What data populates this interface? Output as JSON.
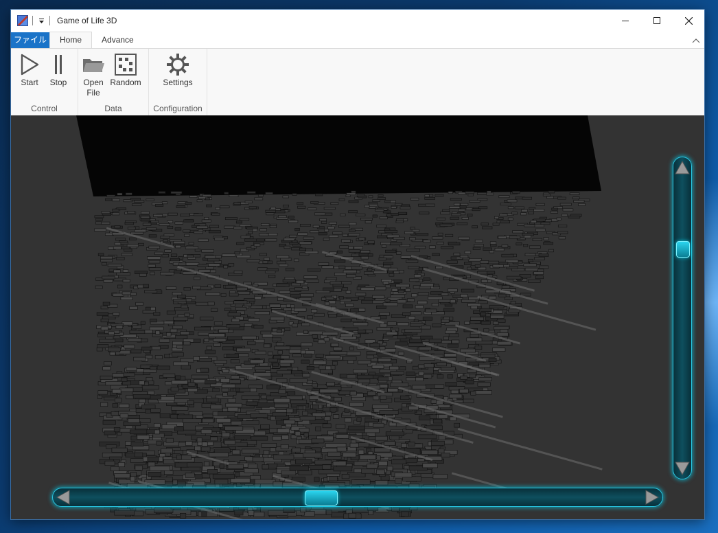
{
  "window": {
    "title": "Game of Life 3D",
    "icon": "app-cube-icon"
  },
  "quick_access": {
    "dropdown_icon": "customize-qat-icon"
  },
  "window_controls": {
    "minimize_icon": "minimize-icon",
    "maximize_icon": "maximize-icon",
    "close_icon": "close-icon"
  },
  "tabs": [
    {
      "label": "ファイル"
    },
    {
      "label": "Home"
    },
    {
      "label": "Advance"
    }
  ],
  "ribbon": {
    "groups": [
      {
        "label": "Control",
        "buttons": [
          {
            "label": "Start",
            "icon": "play-icon"
          },
          {
            "label": "Stop",
            "icon": "pause-icon"
          }
        ]
      },
      {
        "label": "Data",
        "buttons": [
          {
            "label": "Open\nFile",
            "line1": "Open",
            "line2": "File",
            "icon": "folder-icon"
          },
          {
            "label": "Random",
            "icon": "random-grid-icon"
          }
        ]
      },
      {
        "label": "Configuration",
        "buttons": [
          {
            "label": "Settings",
            "icon": "gear-icon"
          }
        ]
      }
    ]
  },
  "viewport": {
    "description_icon": "3d-cells-render",
    "vertical_scroll_fraction": 0.24,
    "horizontal_scroll_fraction": 0.43
  },
  "colors": {
    "accent_file_tab": "#1a73c8",
    "scrollbar_glow": "#29c9e6",
    "viewport_bg": "#333333"
  }
}
